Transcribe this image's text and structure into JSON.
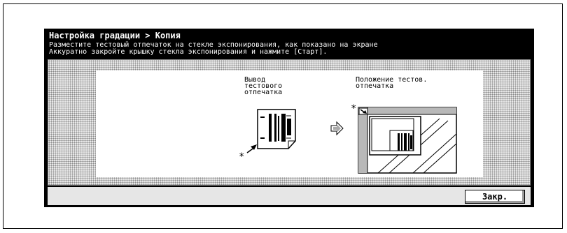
{
  "screen": {
    "title": "Настройка градации > Копия",
    "instruction_line1": "Разместите тестовый отпечаток на стекле экспонирования, как показано на экране",
    "instruction_line2": "Аккуратно закройте крышку стекла экспонирования и нажмите [Старт]."
  },
  "illustration": {
    "output_label": "Вывод\nтестового\nотпечатка",
    "position_label": "Положение тестов.\nотпечатка",
    "marker": "*"
  },
  "footer": {
    "close_label": "Закр."
  }
}
